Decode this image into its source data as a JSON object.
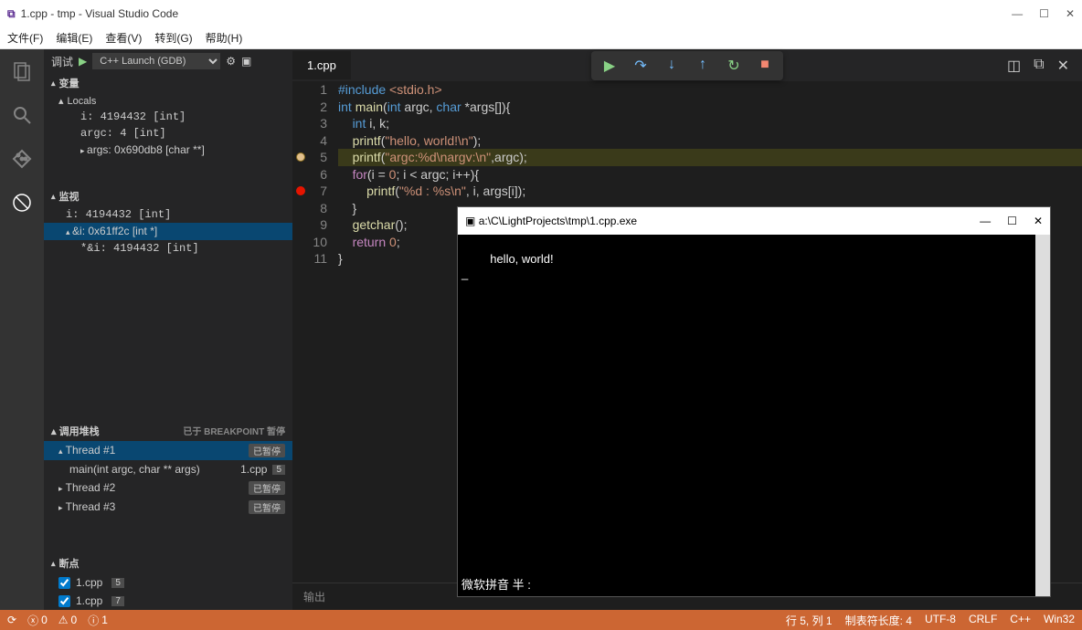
{
  "window": {
    "title": "1.cpp - tmp - Visual Studio Code"
  },
  "menu": {
    "file": "文件(F)",
    "edit": "编辑(E)",
    "view": "查看(V)",
    "goto": "转到(G)",
    "help": "帮助(H)"
  },
  "debugHeader": {
    "label": "调试",
    "launch": "C++ Launch (GDB)"
  },
  "variables": {
    "header": "变量",
    "localsHeader": "Locals",
    "i": "i: 4194432 [int]",
    "argc": "argc: 4 [int]",
    "args": "args: 0x690db8 [char **]"
  },
  "watch": {
    "header": "监视",
    "w1": "i: 4194432 [int]",
    "w2": "&i: 0x61ff2c [int *]",
    "w3": "*&i: 4194432 [int]"
  },
  "callstack": {
    "header": "调用堆栈",
    "status": "已于 BREAKPOINT 暂停",
    "paused": "已暂停",
    "t1": "Thread #1",
    "frame": "main(int argc, char ** args)",
    "frameFile": "1.cpp",
    "frameLine": "5",
    "t2": "Thread #2",
    "t3": "Thread #3"
  },
  "breakpoints": {
    "header": "断点",
    "bp1": "1.cpp",
    "bp1line": "5",
    "bp2": "1.cpp",
    "bp2line": "7"
  },
  "tab": {
    "name": "1.cpp"
  },
  "outputPanel": {
    "label": "输出"
  },
  "code": {
    "lines": [
      {
        "n": "1",
        "html": "<span class='inc'>#include</span> <span class='st'>&lt;stdio.h&gt;</span>"
      },
      {
        "n": "2",
        "html": "<span class='kw'>int</span> <span class='fn'>main</span>(<span class='kw'>int</span> argc, <span class='kw'>char</span> *args[]){"
      },
      {
        "n": "3",
        "html": "    <span class='kw'>int</span> i, k;"
      },
      {
        "n": "4",
        "html": "    <span class='fn'>printf</span>(<span class='st'>\"hello, world!\\n\"</span>);"
      },
      {
        "n": "5",
        "html": "    <span class='fn'>printf</span>(<span class='st'>\"argc:%d\\nargv:\\n\"</span>,argc);",
        "hl": true,
        "bp": "y"
      },
      {
        "n": "6",
        "html": "    <span class='pp'>for</span>(i = <span class='st'>0</span>; i &lt; argc; i++){"
      },
      {
        "n": "7",
        "html": "        <span class='fn'>printf</span>(<span class='st'>\"%d : %s\\n\"</span>, i, args[i]);",
        "bp": "r"
      },
      {
        "n": "8",
        "html": "    }"
      },
      {
        "n": "9",
        "html": "    <span class='fn'>getchar</span>();"
      },
      {
        "n": "10",
        "html": "    <span class='pp'>return</span> <span class='st'>0</span>;"
      },
      {
        "n": "11",
        "html": "}"
      }
    ]
  },
  "console": {
    "title": "a:\\C\\LightProjects\\tmp\\1.cpp.exe",
    "output": "hello, world!\n_",
    "ime": "微软拼音 半 :"
  },
  "status": {
    "errors": "0",
    "warnings": "0",
    "info": "1",
    "pos": "行 5, 列 1",
    "tab": "制表符长度: 4",
    "enc": "UTF-8",
    "eol": "CRLF",
    "lang": "C++",
    "os": "Win32"
  }
}
